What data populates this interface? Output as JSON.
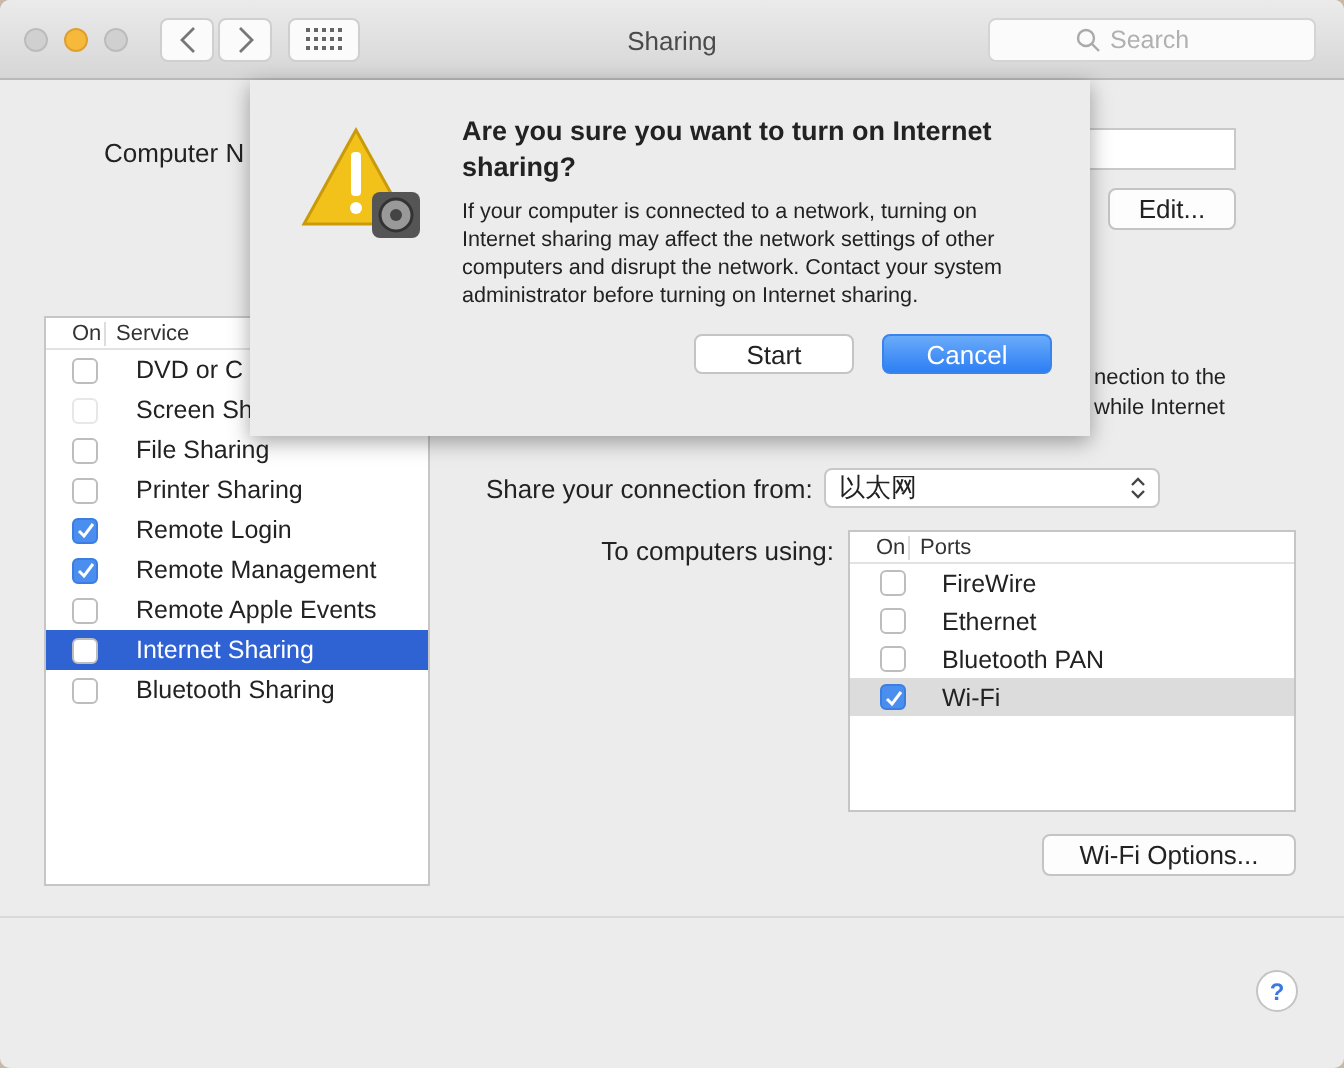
{
  "window": {
    "title": "Sharing",
    "search": {
      "placeholder": "Search"
    }
  },
  "computer_name": {
    "label": "Computer N"
  },
  "edit_button": "Edit...",
  "services": {
    "columns": [
      "On",
      "Service"
    ],
    "rows": [
      {
        "name": "DVD or C",
        "checked": false,
        "selected": false,
        "disabled": false
      },
      {
        "name": "Screen Sh",
        "checked": false,
        "selected": false,
        "disabled": true
      },
      {
        "name": "File Sharing",
        "checked": false,
        "selected": false,
        "disabled": false
      },
      {
        "name": "Printer Sharing",
        "checked": false,
        "selected": false,
        "disabled": false
      },
      {
        "name": "Remote Login",
        "checked": true,
        "selected": false,
        "disabled": false
      },
      {
        "name": "Remote Management",
        "checked": true,
        "selected": false,
        "disabled": false
      },
      {
        "name": "Remote Apple Events",
        "checked": false,
        "selected": false,
        "disabled": false
      },
      {
        "name": "Internet Sharing",
        "checked": false,
        "selected": true,
        "disabled": false
      },
      {
        "name": "Bluetooth Sharing",
        "checked": false,
        "selected": false,
        "disabled": false
      }
    ]
  },
  "description_lines": [
    "nection to the",
    "while Internet"
  ],
  "share_from": {
    "label": "Share your connection from:",
    "value": "以太网"
  },
  "to_computers": {
    "label": "To computers using:",
    "columns": [
      "On",
      "Ports"
    ],
    "rows": [
      {
        "name": "FireWire",
        "checked": false,
        "selected": false
      },
      {
        "name": "Ethernet",
        "checked": false,
        "selected": false
      },
      {
        "name": "Bluetooth PAN",
        "checked": false,
        "selected": false
      },
      {
        "name": "Wi-Fi",
        "checked": true,
        "selected": true
      }
    ]
  },
  "options_button": "Wi-Fi Options...",
  "help_button": "?",
  "dialog": {
    "title": "Are you sure you want to turn on Internet sharing?",
    "message": "If your computer is connected to a network, turning on Internet sharing may affect the network settings of other computers and disrupt the network. Contact your system administrator before turning on Internet sharing.",
    "buttons": [
      {
        "label": "Start",
        "default": false
      },
      {
        "label": "Cancel",
        "default": true
      }
    ]
  }
}
